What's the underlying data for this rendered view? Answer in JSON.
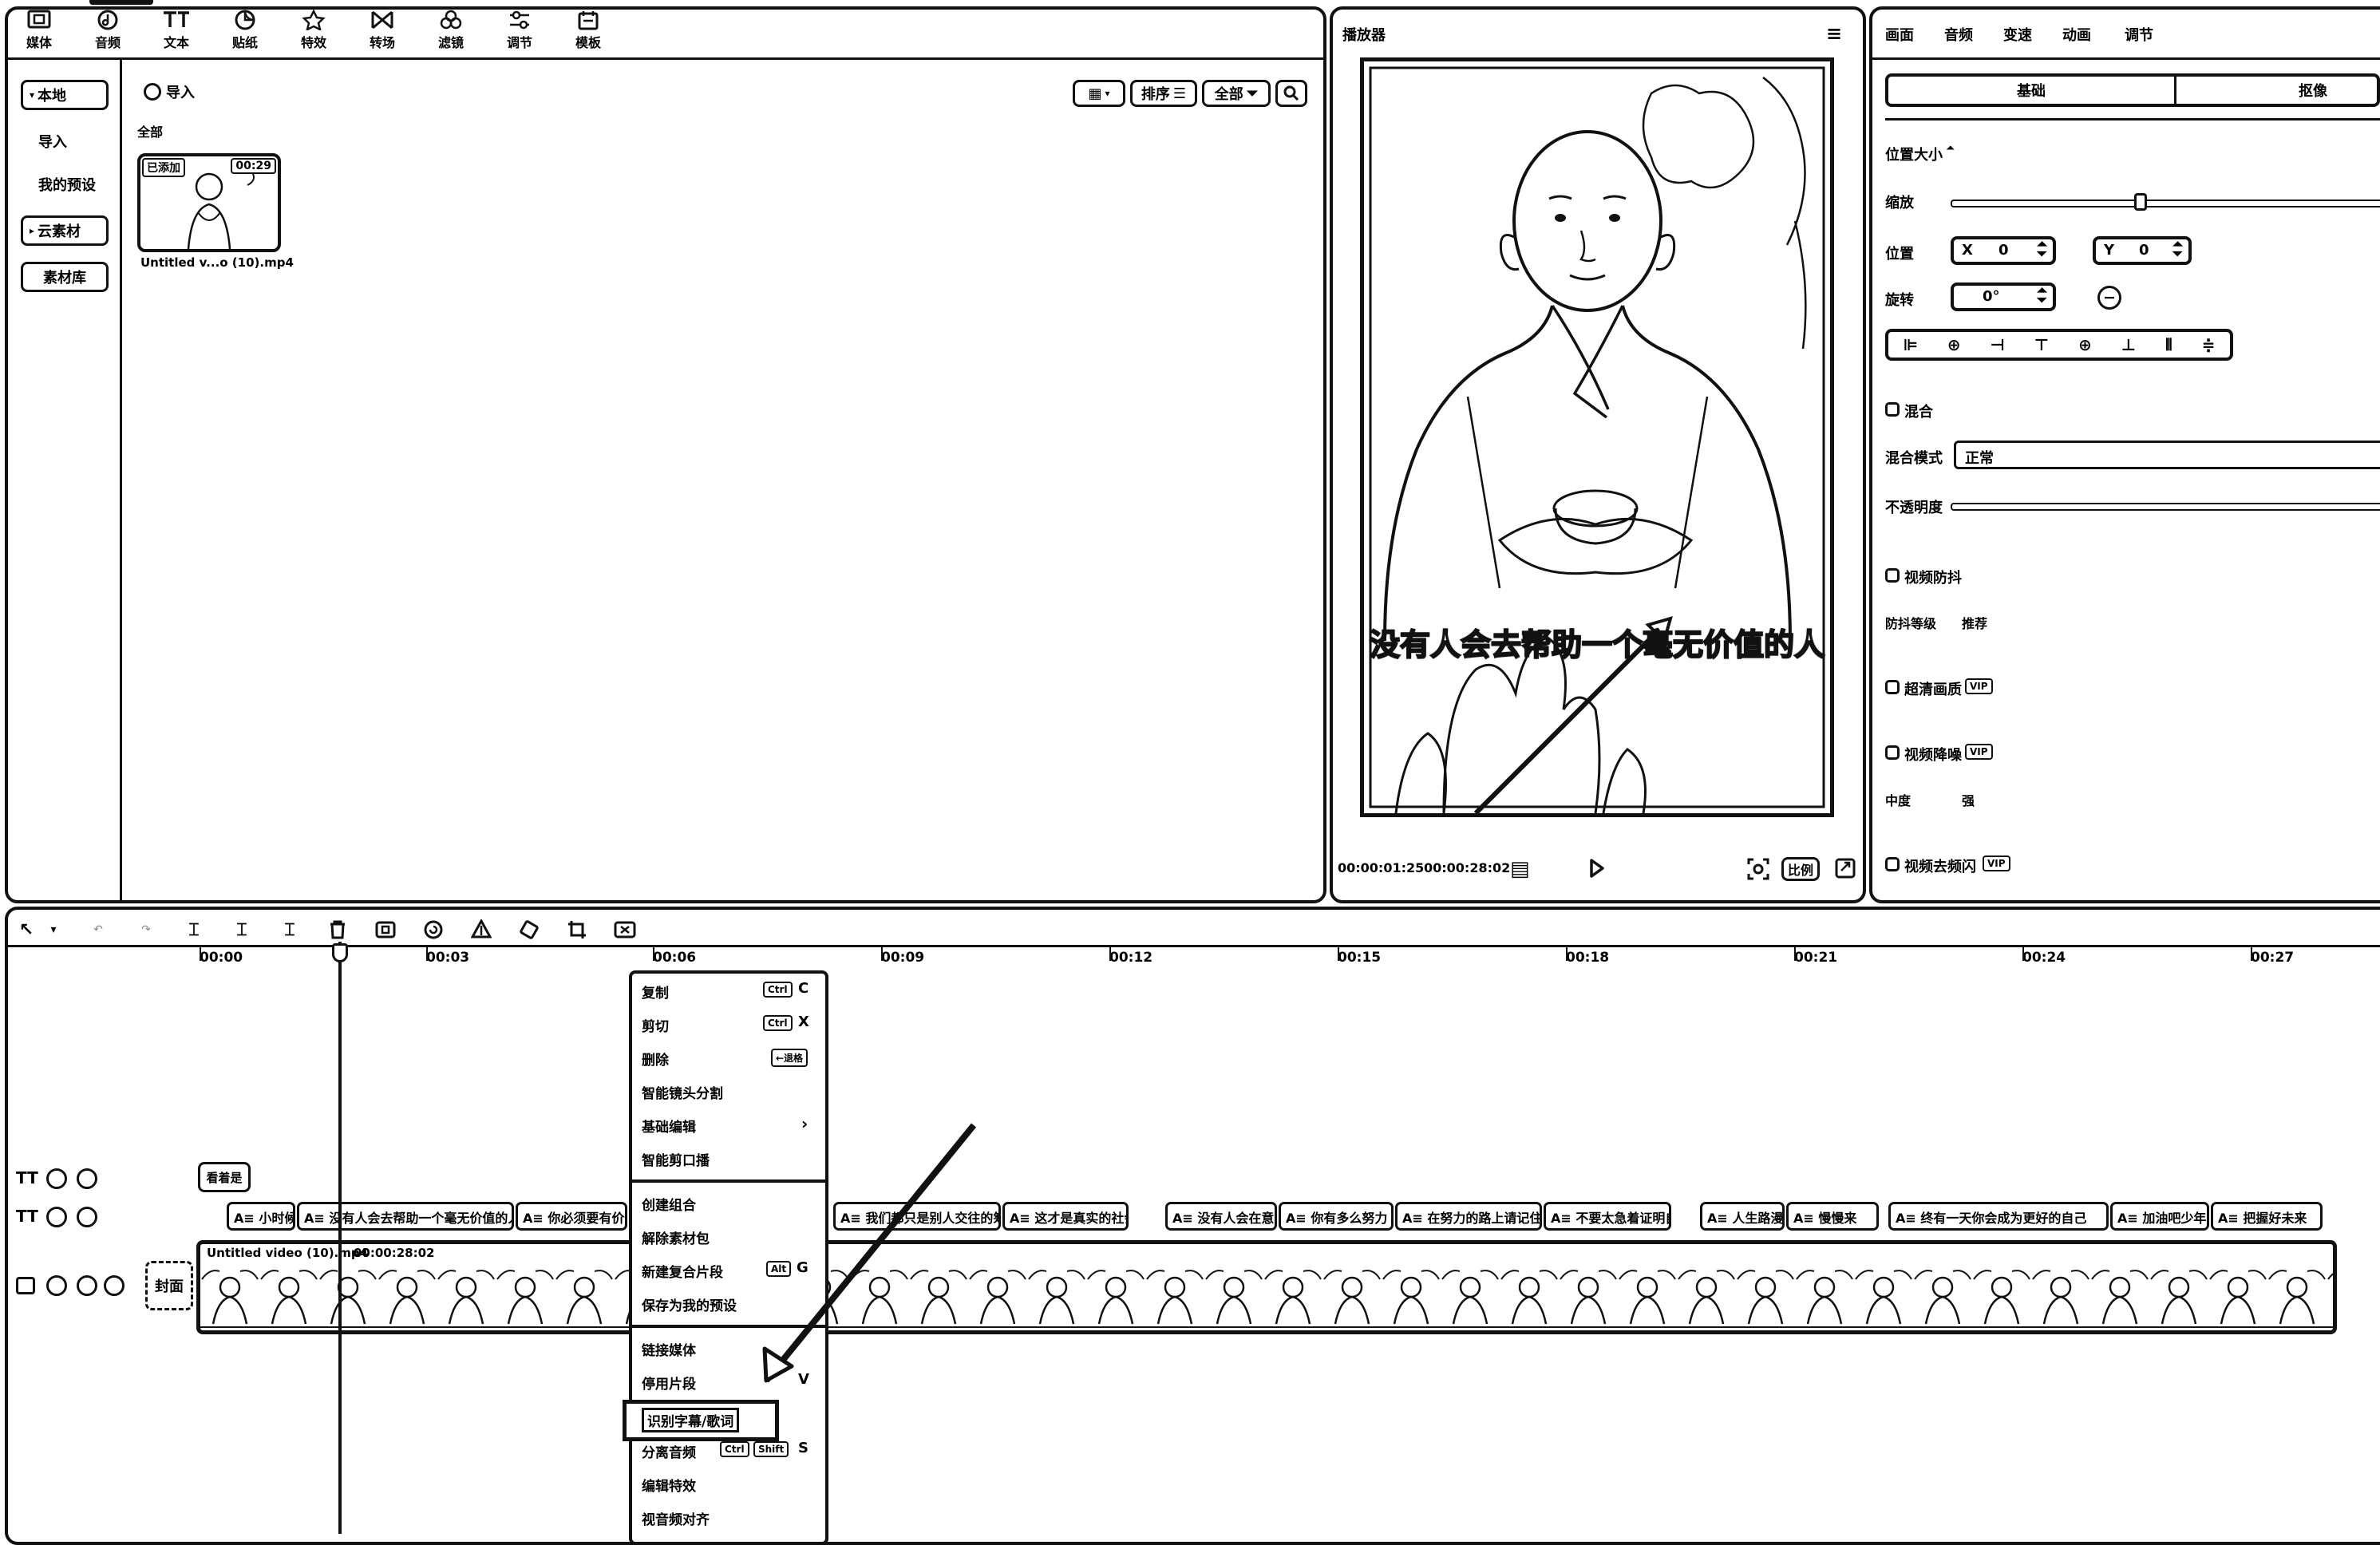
{
  "toolbar": {
    "items": [
      {
        "label": "媒体",
        "icon": "media-icon"
      },
      {
        "label": "音频",
        "icon": "audio-icon"
      },
      {
        "label": "文本",
        "icon": "text-icon"
      },
      {
        "label": "贴纸",
        "icon": "sticker-icon"
      },
      {
        "label": "特效",
        "icon": "effects-icon"
      },
      {
        "label": "转场",
        "icon": "transition-icon"
      },
      {
        "label": "滤镜",
        "icon": "filter-icon"
      },
      {
        "label": "调节",
        "icon": "adjust-icon"
      },
      {
        "label": "模板",
        "icon": "template-icon"
      }
    ]
  },
  "media_sidebar": {
    "items": [
      "本地",
      "导入",
      "我的预设",
      "云素材",
      "素材库"
    ]
  },
  "media_browser": {
    "import_label": "导入",
    "filter_all_label": "全部",
    "sort_label": "排序",
    "all_dropdown_label": "全部",
    "media_item": {
      "badge": "已添加",
      "duration": "00:29",
      "filename": "Untitled v...o (10).mp4"
    }
  },
  "player": {
    "title": "播放器",
    "subtitle_text": "没有人会去帮助一个毫无价值的人",
    "current_time": "00:00:01:25",
    "total_time": "00:00:28:02",
    "ratio_label": "比例"
  },
  "properties": {
    "tabs": [
      "画面",
      "音频",
      "变速",
      "动画",
      "调节"
    ],
    "subtabs": [
      "基础",
      "抠像"
    ],
    "position_size_label": "位置大小",
    "scale_label": "缩放",
    "position_label": "位置",
    "x_label": "X",
    "x_value": "0",
    "y_label": "Y",
    "y_value": "0",
    "rotation_label": "旋转",
    "rotation_value": "0°",
    "blend_label": "混合",
    "blend_mode_label": "混合模式",
    "blend_mode_value": "正常",
    "opacity_label": "不透明度",
    "stabilize_label": "视频防抖",
    "stabilize_level_label": "防抖等级",
    "stabilize_level_value": "推荐",
    "hd_label": "超清画质",
    "denoise_label": "视频降噪",
    "denoise_level_a": "中度",
    "denoise_level_b": "强",
    "deflicker_label": "视频去频闪",
    "vip": "VIP"
  },
  "timeline": {
    "ticks": [
      "00:00",
      "00:03",
      "00:06",
      "00:09",
      "00:12",
      "00:15",
      "00:18",
      "00:21",
      "00:24",
      "00:27"
    ],
    "text_clip_label": "看着是",
    "video_clip_title": "Untitled video (10).mp4",
    "video_clip_duration": "00:00:28:02",
    "cover_label": "封面",
    "subtitle_clips": [
      "A≡ 小时候",
      "A≡ 没有人会去帮助一个毫无价值的人",
      "A≡ 你必须要有价值",
      "A≡ 我们都只是别人交往的筹码",
      "A≡ 这才是真实的社会",
      "A≡ 没有人会在意",
      "A≡ 你有多么努力",
      "A≡ 在努力的路上请记住",
      "A≡ 不要太急着证明自己",
      "A≡ 人生路漫",
      "A≡ 慢慢来",
      "A≡ 终有一天你会成为更好的自己",
      "A≡ 加油吧少年",
      "A≡ 把握好未来"
    ]
  },
  "context_menu": {
    "items": [
      {
        "label": "复制",
        "keys": [
          "Ctrl"
        ],
        "letter": "C"
      },
      {
        "label": "剪切",
        "keys": [
          "Ctrl"
        ],
        "letter": "X"
      },
      {
        "label": "删除",
        "keys": [
          "←退格"
        ],
        "letter": ""
      },
      {
        "label": "智能镜头分割",
        "keys": [],
        "letter": ""
      },
      {
        "label": "基础编辑",
        "keys": [],
        "letter": ""
      },
      {
        "label": "智能剪口播",
        "keys": [],
        "letter": ""
      },
      {
        "label": "创建组合",
        "keys": [],
        "letter": ""
      },
      {
        "label": "解除素材包",
        "keys": [],
        "letter": ""
      },
      {
        "label": "新建复合片段",
        "keys": [
          "Alt"
        ],
        "letter": "G"
      },
      {
        "label": "保存为我的预设",
        "keys": [],
        "letter": ""
      },
      {
        "label": "链接媒体",
        "keys": [],
        "letter": ""
      },
      {
        "label": "停用片段",
        "keys": [],
        "letter": "V"
      },
      {
        "label": "识别字幕/歌词",
        "keys": [],
        "letter": ""
      },
      {
        "label": "分离音频",
        "keys": [
          "Ctrl",
          "Shift"
        ],
        "letter": "S"
      },
      {
        "label": "编辑特效",
        "keys": [],
        "letter": ""
      },
      {
        "label": "视音频对齐",
        "keys": [],
        "letter": ""
      }
    ]
  },
  "colors": {
    "stroke": "#111111",
    "background": "#ffffff"
  }
}
